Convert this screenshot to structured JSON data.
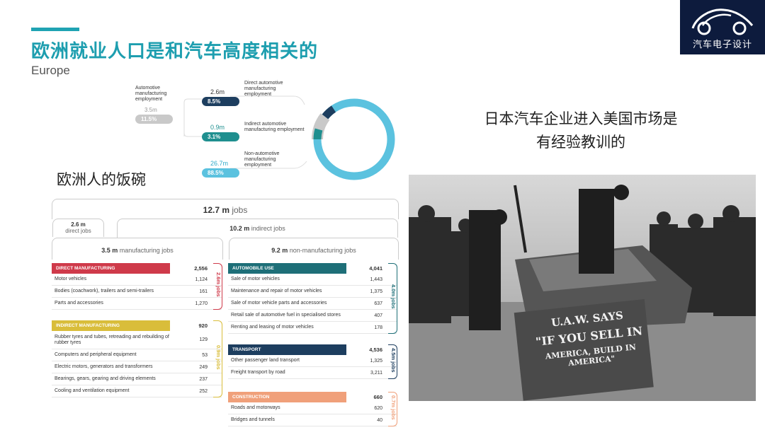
{
  "header": {
    "title": "欧洲就业人口是和汽车高度相关的",
    "subtitle": "Europe"
  },
  "logo": {
    "text": "汽车电子设计",
    "icon": "car-outline-logo"
  },
  "donut": {
    "auto": {
      "label": "Automotive manufacturing employment",
      "value": "3.5m",
      "pct": "11.5%",
      "color": "#c9c9c9"
    },
    "direct": {
      "label": "Direct automotive manufacturing employment",
      "value": "2.6m",
      "pct": "8.5%",
      "color": "#1d3e5f"
    },
    "indirect": {
      "label": "Indirect automotive manufacturing employment",
      "value": "0.9m",
      "pct": "3.1%",
      "color": "#1f8f8f"
    },
    "non": {
      "label": "Non-automotive manufacturing employment",
      "value": "26.7m",
      "pct": "88.5%",
      "color": "#5bc2df"
    }
  },
  "cn_left": "欧洲人的饭碗",
  "cn_right": [
    "日本汽车企业进入美国市场是",
    "有经验教训的"
  ],
  "jobs": {
    "total": {
      "num": "12.7 m",
      "unit": "jobs"
    },
    "direct": {
      "num": "2.6 m",
      "unit": "direct jobs"
    },
    "indirect": {
      "num": "10.2 m",
      "unit": "indirect jobs"
    },
    "manufacturing": {
      "num": "3.5 m",
      "unit": "manufacturing jobs"
    },
    "non_manufacturing": {
      "num": "9.2 m",
      "unit": "non-manufacturing jobs"
    }
  },
  "tables": {
    "direct_manufacturing": {
      "title": "DIRECT MANUFACTURING",
      "total": "2,556",
      "side": "2.6m jobs",
      "color": "#cf3a4a",
      "rows": [
        {
          "label": "Motor vehicles",
          "value": "1,124"
        },
        {
          "label": "Bodies (coachwork), trailers and semi-trailers",
          "value": "161"
        },
        {
          "label": "Parts and accessories",
          "value": "1,270"
        }
      ]
    },
    "indirect_manufacturing": {
      "title": "INDIRECT MANUFACTURING",
      "total": "920",
      "side": "0.9m jobs",
      "color": "#d9bd3a",
      "rows": [
        {
          "label": "Rubber tyres and tubes, retreading and rebuilding of rubber tyres",
          "value": "129"
        },
        {
          "label": "Computers and peripheral equipment",
          "value": "53"
        },
        {
          "label": "Electric motors, generators and transformers",
          "value": "249"
        },
        {
          "label": "Bearings, gears, gearing and driving elements",
          "value": "237"
        },
        {
          "label": "Cooling and ventilation equipment",
          "value": "252"
        }
      ]
    },
    "automobile_use": {
      "title": "AUTOMOBILE USE",
      "total": "4,041",
      "side": "4.0m jobs",
      "color": "#1e6f78",
      "rows": [
        {
          "label": "Sale of motor vehicles",
          "value": "1,443"
        },
        {
          "label": "Maintenance and repair of motor vehicles",
          "value": "1,375"
        },
        {
          "label": "Sale of motor vehicle parts and accessories",
          "value": "637"
        },
        {
          "label": "Retail sale of automotive fuel in specialised stores",
          "value": "407"
        },
        {
          "label": "Renting and leasing of motor vehicles",
          "value": "178"
        }
      ]
    },
    "transport": {
      "title": "TRANSPORT",
      "total": "4,536",
      "side": "4.5m jobs",
      "color": "#1d3e5f",
      "rows": [
        {
          "label": "Other passenger land transport",
          "value": "1,325"
        },
        {
          "label": "Freight transport by road",
          "value": "3,211"
        }
      ]
    },
    "construction": {
      "title": "CONSTRUCTION",
      "total": "660",
      "side": "0.7m jobs",
      "color": "#f0a07a",
      "rows": [
        {
          "label": "Roads and motorways",
          "value": "620"
        },
        {
          "label": "Bridges and tunnels",
          "value": "40"
        }
      ]
    }
  },
  "photo": {
    "sign_lines": [
      "U.A.W. SAYS",
      "\"IF YOU SELL IN",
      "AMERICA, BUILD IN AMERICA\""
    ]
  }
}
